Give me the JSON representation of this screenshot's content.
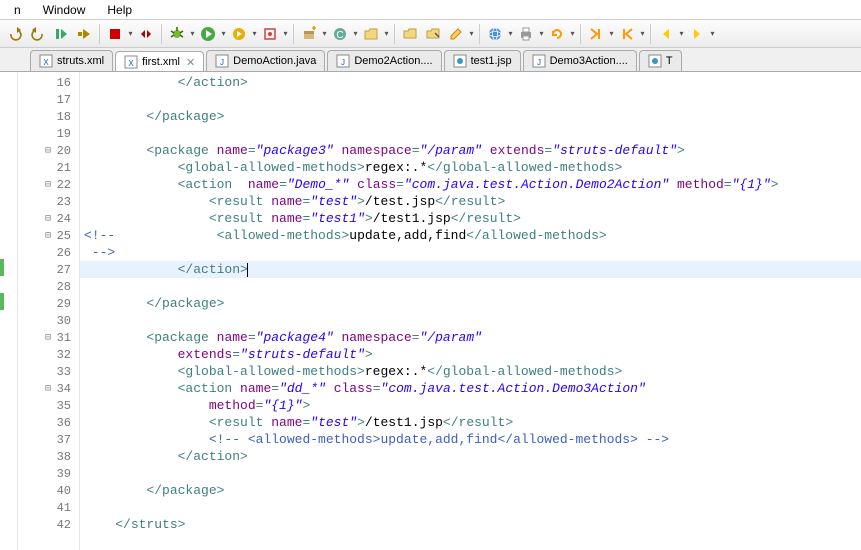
{
  "menu": {
    "items": [
      "n",
      "Window",
      "Help"
    ]
  },
  "tabs": [
    {
      "label": "struts.xml",
      "icon": "xml",
      "active": false
    },
    {
      "label": "first.xml",
      "icon": "xml",
      "active": true
    },
    {
      "label": "DemoAction.java",
      "icon": "java",
      "active": false
    },
    {
      "label": "Demo2Action....",
      "icon": "java",
      "active": false
    },
    {
      "label": "test1.jsp",
      "icon": "jsp",
      "active": false
    },
    {
      "label": "Demo3Action....",
      "icon": "java",
      "active": false
    },
    {
      "label": "T",
      "icon": "jsp",
      "active": false
    }
  ],
  "editor": {
    "first_line_number": 16,
    "highlight_line": 27,
    "lines": [
      {
        "n": 16,
        "fold": "",
        "green": false,
        "seg": [
          [
            "            ",
            "txt"
          ],
          [
            "</action>",
            "tag"
          ]
        ]
      },
      {
        "n": 17,
        "fold": "",
        "green": false,
        "seg": []
      },
      {
        "n": 18,
        "fold": "",
        "green": false,
        "seg": [
          [
            "        ",
            "txt"
          ],
          [
            "</package>",
            "tag"
          ]
        ]
      },
      {
        "n": 19,
        "fold": "",
        "green": false,
        "seg": []
      },
      {
        "n": 20,
        "fold": "minus",
        "green": false,
        "seg": [
          [
            "        ",
            "txt"
          ],
          [
            "<package ",
            "tag"
          ],
          [
            "name",
            "attr"
          ],
          [
            "=",
            "tag"
          ],
          [
            "\"package3\"",
            "str"
          ],
          [
            " ",
            "txt"
          ],
          [
            "namespace",
            "attr"
          ],
          [
            "=",
            "tag"
          ],
          [
            "\"/param\"",
            "str"
          ],
          [
            " ",
            "txt"
          ],
          [
            "extends",
            "attr"
          ],
          [
            "=",
            "tag"
          ],
          [
            "\"struts-default\"",
            "str"
          ],
          [
            ">",
            "tag"
          ]
        ]
      },
      {
        "n": 21,
        "fold": "",
        "green": false,
        "seg": [
          [
            "            ",
            "txt"
          ],
          [
            "<global-allowed-methods>",
            "tag"
          ],
          [
            "regex:.*",
            "txt"
          ],
          [
            "</global-allowed-methods>",
            "tag"
          ]
        ]
      },
      {
        "n": 22,
        "fold": "minus",
        "green": false,
        "seg": [
          [
            "            ",
            "txt"
          ],
          [
            "<action  ",
            "tag"
          ],
          [
            "name",
            "attr"
          ],
          [
            "=",
            "tag"
          ],
          [
            "\"Demo_*\"",
            "str"
          ],
          [
            " ",
            "txt"
          ],
          [
            "class",
            "attr"
          ],
          [
            "=",
            "tag"
          ],
          [
            "\"com.java.test.Action.Demo2Action\"",
            "str"
          ],
          [
            " ",
            "txt"
          ],
          [
            "method",
            "attr"
          ],
          [
            "=",
            "tag"
          ],
          [
            "\"{1}\"",
            "str"
          ],
          [
            ">",
            "tag"
          ]
        ]
      },
      {
        "n": 23,
        "fold": "",
        "green": false,
        "seg": [
          [
            "                ",
            "txt"
          ],
          [
            "<result ",
            "tag"
          ],
          [
            "name",
            "attr"
          ],
          [
            "=",
            "tag"
          ],
          [
            "\"test\"",
            "str"
          ],
          [
            ">",
            "tag"
          ],
          [
            "/test.jsp",
            "txt"
          ],
          [
            "</result>",
            "tag"
          ]
        ]
      },
      {
        "n": 24,
        "fold": "minus",
        "green": false,
        "seg": [
          [
            "                ",
            "txt"
          ],
          [
            "<result ",
            "tag"
          ],
          [
            "name",
            "attr"
          ],
          [
            "=",
            "tag"
          ],
          [
            "\"test1\"",
            "str"
          ],
          [
            ">",
            "tag"
          ],
          [
            "/test1.jsp",
            "txt"
          ],
          [
            "</result>",
            "tag"
          ]
        ]
      },
      {
        "n": 25,
        "fold": "minus",
        "green": false,
        "seg": [
          [
            "<!--",
            "cmt"
          ],
          [
            "             ",
            "txt"
          ],
          [
            "<allowed-methods>",
            "tag"
          ],
          [
            "update,add,find",
            "txt"
          ],
          [
            "</allowed-methods>",
            "tag"
          ]
        ]
      },
      {
        "n": 26,
        "fold": "",
        "green": false,
        "seg": [
          [
            " -->",
            "cmt"
          ]
        ]
      },
      {
        "n": 27,
        "fold": "",
        "green": true,
        "seg": [
          [
            "            ",
            "txt"
          ],
          [
            "</action>",
            "tag"
          ]
        ]
      },
      {
        "n": 28,
        "fold": "",
        "green": false,
        "seg": []
      },
      {
        "n": 29,
        "fold": "",
        "green": true,
        "seg": [
          [
            "        ",
            "txt"
          ],
          [
            "</package>",
            "tag"
          ]
        ]
      },
      {
        "n": 30,
        "fold": "",
        "green": false,
        "seg": []
      },
      {
        "n": 31,
        "fold": "minus",
        "green": false,
        "seg": [
          [
            "        ",
            "txt"
          ],
          [
            "<package ",
            "tag"
          ],
          [
            "name",
            "attr"
          ],
          [
            "=",
            "tag"
          ],
          [
            "\"package4\"",
            "str"
          ],
          [
            " ",
            "txt"
          ],
          [
            "namespace",
            "attr"
          ],
          [
            "=",
            "tag"
          ],
          [
            "\"/param\"",
            "str"
          ]
        ]
      },
      {
        "n": 32,
        "fold": "",
        "green": false,
        "seg": [
          [
            "            ",
            "txt"
          ],
          [
            "extends",
            "attr"
          ],
          [
            "=",
            "tag"
          ],
          [
            "\"struts-default\"",
            "str"
          ],
          [
            ">",
            "tag"
          ]
        ]
      },
      {
        "n": 33,
        "fold": "",
        "green": false,
        "seg": [
          [
            "            ",
            "txt"
          ],
          [
            "<global-allowed-methods>",
            "tag"
          ],
          [
            "regex:.*",
            "txt"
          ],
          [
            "</global-allowed-methods>",
            "tag"
          ]
        ]
      },
      {
        "n": 34,
        "fold": "minus",
        "green": false,
        "seg": [
          [
            "            ",
            "txt"
          ],
          [
            "<action ",
            "tag"
          ],
          [
            "name",
            "attr"
          ],
          [
            "=",
            "tag"
          ],
          [
            "\"dd_*\"",
            "str"
          ],
          [
            " ",
            "txt"
          ],
          [
            "class",
            "attr"
          ],
          [
            "=",
            "tag"
          ],
          [
            "\"com.java.test.Action.Demo3Action\"",
            "str"
          ]
        ]
      },
      {
        "n": 35,
        "fold": "",
        "green": false,
        "seg": [
          [
            "                ",
            "txt"
          ],
          [
            "method",
            "attr"
          ],
          [
            "=",
            "tag"
          ],
          [
            "\"{1}\"",
            "str"
          ],
          [
            ">",
            "tag"
          ]
        ]
      },
      {
        "n": 36,
        "fold": "",
        "green": false,
        "seg": [
          [
            "                ",
            "txt"
          ],
          [
            "<result ",
            "tag"
          ],
          [
            "name",
            "attr"
          ],
          [
            "=",
            "tag"
          ],
          [
            "\"test\"",
            "str"
          ],
          [
            ">",
            "tag"
          ],
          [
            "/test1.jsp",
            "txt"
          ],
          [
            "</result>",
            "tag"
          ]
        ]
      },
      {
        "n": 37,
        "fold": "",
        "green": false,
        "seg": [
          [
            "                ",
            "txt"
          ],
          [
            "<!-- <allowed-methods>update,add,find</allowed-methods> -->",
            "cmt"
          ]
        ]
      },
      {
        "n": 38,
        "fold": "",
        "green": false,
        "seg": [
          [
            "            ",
            "txt"
          ],
          [
            "</action>",
            "tag"
          ]
        ]
      },
      {
        "n": 39,
        "fold": "",
        "green": false,
        "seg": []
      },
      {
        "n": 40,
        "fold": "",
        "green": false,
        "seg": [
          [
            "        ",
            "txt"
          ],
          [
            "</package>",
            "tag"
          ]
        ]
      },
      {
        "n": 41,
        "fold": "",
        "green": false,
        "seg": []
      },
      {
        "n": 42,
        "fold": "",
        "green": false,
        "seg": [
          [
            "    ",
            "txt"
          ],
          [
            "</struts>",
            "tag"
          ]
        ]
      }
    ]
  }
}
